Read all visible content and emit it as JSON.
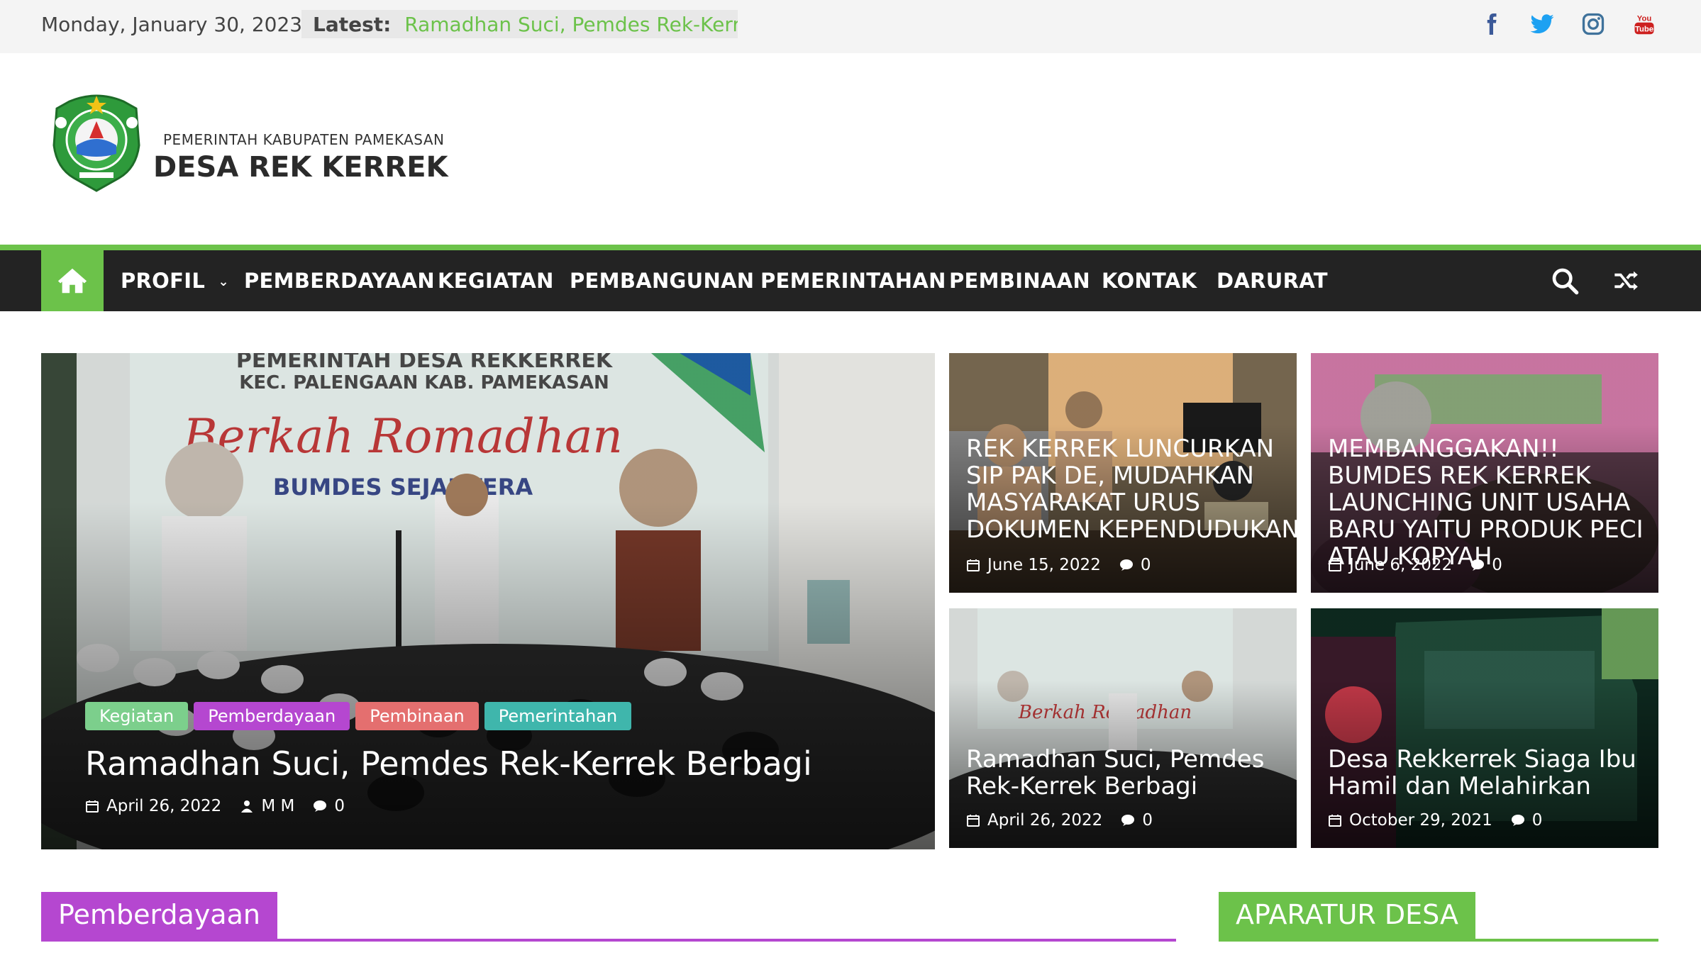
{
  "topbar": {
    "date": "Monday, January 30, 2023",
    "latest_label": "Latest:",
    "latest_link": "Ramadhan Suci, Pemdes Rek-Kerrek",
    "social": [
      "facebook-icon",
      "twitter-icon",
      "instagram-icon",
      "youtube-icon"
    ]
  },
  "logo": {
    "subtitle": "PEMERINTAH KABUPATEN PAMEKASAN",
    "title": "DESA REK KERREK"
  },
  "nav": {
    "items": [
      {
        "label": "PROFIL"
      },
      {
        "label": "PEMBERDAYAAN"
      },
      {
        "label": "KEGIATAN"
      },
      {
        "label": "PEMBANGUNAN"
      },
      {
        "label": "PEMERINTAHAN"
      },
      {
        "label": "PEMBINAAN"
      },
      {
        "label": "KONTAK"
      },
      {
        "label": "DARURAT"
      }
    ]
  },
  "featured": {
    "categories": [
      {
        "label": "Kegiatan",
        "color": "#7ccf8c"
      },
      {
        "label": "Pemberdayaan",
        "color": "#b547d0"
      },
      {
        "label": "Pembinaan",
        "color": "#e46f6f"
      },
      {
        "label": "Pemerintahan",
        "color": "#3fb6ac"
      }
    ],
    "title": "Ramadhan Suci, Pemdes Rek-Kerrek Berbagi",
    "date": "April 26, 2022",
    "author": "M M",
    "comments": "0"
  },
  "posts": [
    {
      "title": "REK KERREK LUNCURKAN SIP PAK DE, MUDAHKAN MASYARAKAT URUS DOKUMEN KEPENDUDUKAN",
      "date": "June 15, 2022",
      "comments": "0"
    },
    {
      "title": "MEMBANGGAKAN!! BUMDES REK KERREK LAUNCHING UNIT USAHA BARU YAITU PRODUK PECI ATAU KOPYAH",
      "date": "June 6, 2022",
      "comments": "0"
    },
    {
      "title": "Ramadhan Suci, Pemdes Rek-Kerrek Berbagi",
      "date": "April 26, 2022",
      "comments": "0"
    },
    {
      "title": "Desa Rekkerrek Siaga Ibu Hamil dan Melahirkan",
      "date": "October 29, 2021",
      "comments": "0"
    }
  ],
  "sections": {
    "left_title": "Pemberdayaan",
    "left_color": "#b547d0",
    "right_title": "APARATUR DESA",
    "right_color": "#6cc24a"
  },
  "colors": {
    "accent": "#6cc24a",
    "nav_bg": "#232323",
    "facebook": "#3b5998",
    "twitter": "#1da1f2",
    "instagram": "#3f729b",
    "youtube": "#cd201f"
  }
}
